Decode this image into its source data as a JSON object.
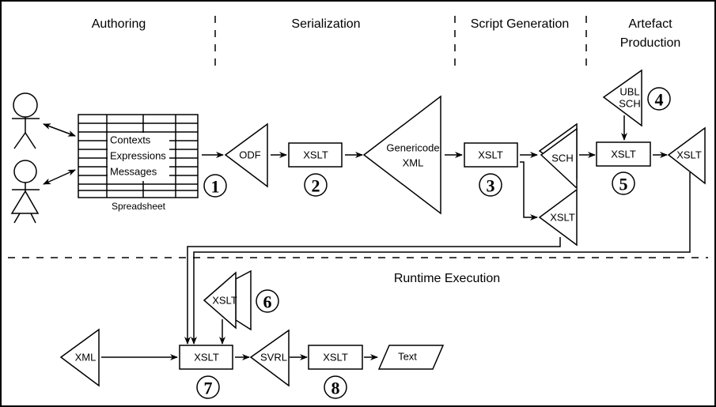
{
  "phases": {
    "authoring": "Authoring",
    "serialization": "Serialization",
    "script_generation": "Script Generation",
    "artefact_production_line1": "Artefact",
    "artefact_production_line2": "Production",
    "runtime_execution": "Runtime Execution"
  },
  "spreadsheet": {
    "rows": [
      "Contexts",
      "Expressions",
      "Messages"
    ],
    "label": "Spreadsheet"
  },
  "nodes": {
    "odf": "ODF",
    "xslt2": "XSLT",
    "genericode_line1": "Genericode",
    "genericode_line2": "XML",
    "xslt3": "XSLT",
    "sch": "SCH",
    "xslt_gen": "XSLT",
    "ubl_line1": "UBL",
    "ubl_line2": "SCH",
    "xslt5": "XSLT",
    "xslt_out": "XSLT",
    "xslt6": "XSLT",
    "xml": "XML",
    "xslt7": "XSLT",
    "svrl": "SVRL",
    "xslt8": "XSLT",
    "text": "Text"
  },
  "steps": [
    "1",
    "2",
    "3",
    "4",
    "5",
    "6",
    "7",
    "8"
  ]
}
